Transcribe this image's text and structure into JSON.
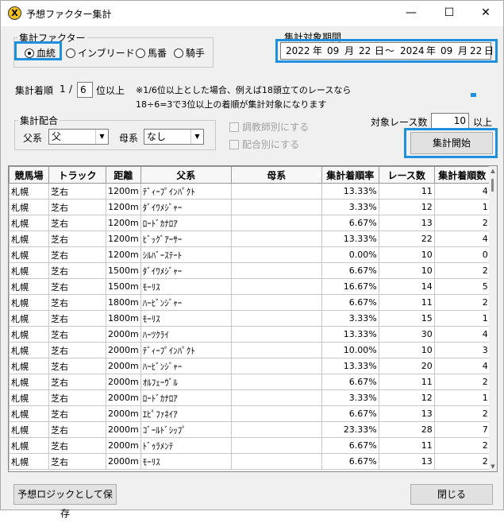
{
  "window": {
    "title": "予想ファクター集計",
    "icon_letter": "X",
    "minimize": "—",
    "maximize": "☐",
    "close": "✕"
  },
  "factor": {
    "legend": "集計ファクター",
    "options": [
      "血統",
      "インブリード",
      "馬番",
      "騎手"
    ],
    "selected": "血統"
  },
  "period": {
    "legend": "集計対象期間",
    "from_year": "2022",
    "year_unit": "年",
    "from_month": "09",
    "month_unit": "月",
    "from_day": "22",
    "day_unit": "日",
    "tilde": "～",
    "to_year": "2024",
    "to_month": "09",
    "to_day": "22",
    "to_day_unit": "日"
  },
  "rank": {
    "label": "集計着順",
    "numerator": "1",
    "slash": "/",
    "value": "6",
    "suffix": "位以上",
    "note_line1": "※1/6位以上とした場合、例えば18頭立てのレースなら",
    "note_line2": "18÷6=3で3位以上の着順が集計対象になります"
  },
  "pairing": {
    "legend": "集計配合",
    "sire_label": "父系",
    "sire_value": "父",
    "dam_label": "母系",
    "dam_value": "なし"
  },
  "checks": {
    "trainer": "調教師別にする",
    "mating": "配合別にする"
  },
  "race_count": {
    "label": "対象レース数",
    "value": "10",
    "suffix": "以上"
  },
  "buttons": {
    "start": "集計開始",
    "save": "予想ロジックとして保存",
    "close": "閉じる"
  },
  "table": {
    "columns": [
      "競馬場",
      "トラック",
      "距離",
      "父系",
      "母系",
      "集計着順率",
      "レース数",
      "集計着順数"
    ],
    "rows": [
      [
        "札幌",
        "芝右",
        "1200m",
        "ﾃﾞｨｰﾌﾟｲﾝﾊﾟｸﾄ",
        "",
        "13.33%",
        "11",
        "4"
      ],
      [
        "札幌",
        "芝右",
        "1200m",
        "ﾀﾞｲﾜﾒｼﾞｬｰ",
        "",
        "3.33%",
        "12",
        "1"
      ],
      [
        "札幌",
        "芝右",
        "1200m",
        "ﾛｰﾄﾞｶﾅﾛｱ",
        "",
        "6.67%",
        "13",
        "2"
      ],
      [
        "札幌",
        "芝右",
        "1200m",
        "ﾋﾞｯｸﾞｱｰｻｰ",
        "",
        "13.33%",
        "22",
        "4"
      ],
      [
        "札幌",
        "芝右",
        "1200m",
        "ｼﾙﾊﾞｰｽﾃｰﾄ",
        "",
        "0.00%",
        "10",
        "0"
      ],
      [
        "札幌",
        "芝右",
        "1500m",
        "ﾀﾞｲﾜﾒｼﾞｬｰ",
        "",
        "6.67%",
        "10",
        "2"
      ],
      [
        "札幌",
        "芝右",
        "1500m",
        "ﾓｰﾘｽ",
        "",
        "16.67%",
        "14",
        "5"
      ],
      [
        "札幌",
        "芝右",
        "1800m",
        "ﾊｰﾋﾞﾝｼﾞｬｰ",
        "",
        "6.67%",
        "11",
        "2"
      ],
      [
        "札幌",
        "芝右",
        "1800m",
        "ﾓｰﾘｽ",
        "",
        "3.33%",
        "15",
        "1"
      ],
      [
        "札幌",
        "芝右",
        "2000m",
        "ﾊｰﾂｸﾗｲ",
        "",
        "13.33%",
        "30",
        "4"
      ],
      [
        "札幌",
        "芝右",
        "2000m",
        "ﾃﾞｨｰﾌﾟｲﾝﾊﾟｸﾄ",
        "",
        "10.00%",
        "10",
        "3"
      ],
      [
        "札幌",
        "芝右",
        "2000m",
        "ﾊｰﾋﾞﾝｼﾞｬｰ",
        "",
        "13.33%",
        "20",
        "4"
      ],
      [
        "札幌",
        "芝右",
        "2000m",
        "ｵﾙﾌｪｰｳﾞﾙ",
        "",
        "6.67%",
        "11",
        "2"
      ],
      [
        "札幌",
        "芝右",
        "2000m",
        "ﾛｰﾄﾞｶﾅﾛｱ",
        "",
        "3.33%",
        "12",
        "1"
      ],
      [
        "札幌",
        "芝右",
        "2000m",
        "ｴﾋﾟﾌｧﾈｲｱ",
        "",
        "6.67%",
        "13",
        "2"
      ],
      [
        "札幌",
        "芝右",
        "2000m",
        "ｺﾞｰﾙﾄﾞｼｯﾌﾟ",
        "",
        "23.33%",
        "28",
        "7"
      ],
      [
        "札幌",
        "芝右",
        "2000m",
        "ﾄﾞｩﾗﾒﾝﾃ",
        "",
        "6.67%",
        "11",
        "2"
      ],
      [
        "札幌",
        "芝右",
        "2000m",
        "ﾓｰﾘｽ",
        "",
        "6.67%",
        "13",
        "2"
      ]
    ]
  },
  "colors": {
    "highlight": "#1e90e0"
  }
}
